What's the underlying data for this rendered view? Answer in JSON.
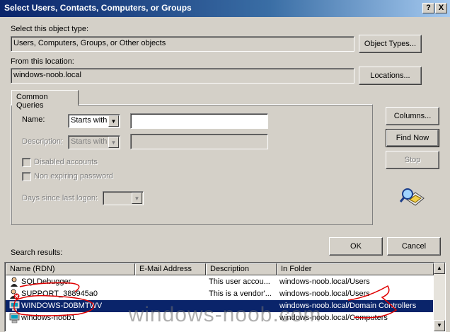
{
  "window": {
    "title": "Select Users, Contacts, Computers, or Groups",
    "help_btn": "?",
    "close_btn": "X"
  },
  "object_type": {
    "label": "Select this object type:",
    "value": "Users, Computers, Groups, or Other objects",
    "button": "Object Types..."
  },
  "location": {
    "label": "From this location:",
    "value": "windows-noob.local",
    "button": "Locations..."
  },
  "common_queries": {
    "tab": "Common Queries",
    "name_label": "Name:",
    "name_mode": "Starts with",
    "name_value": "",
    "description_label": "Description:",
    "description_mode": "Starts with",
    "disabled_accounts": "Disabled accounts",
    "non_expiring_password": "Non expiring password",
    "days_since_logon": "Days since last logon:"
  },
  "buttons": {
    "columns": "Columns...",
    "find_now": "Find Now",
    "stop": "Stop",
    "ok": "OK",
    "cancel": "Cancel"
  },
  "results": {
    "label": "Search results:",
    "columns": [
      "Name (RDN)",
      "E-Mail Address",
      "Description",
      "In Folder"
    ],
    "rows": [
      {
        "name": "SQLDebugger",
        "email": "",
        "description": "This user accou...",
        "folder": "windows-noob.local/Users"
      },
      {
        "name": "SUPPORT_388945a0",
        "email": "",
        "description": "This is a vendor'...",
        "folder": "windows-noob.local/Users"
      },
      {
        "name": "WINDOWS-D0BMTWV",
        "email": "",
        "description": "",
        "folder": "windows-noob.local/Domain Controllers"
      },
      {
        "name": "windows-noob1",
        "email": "",
        "description": "",
        "folder": "windows-noob.local/Computers"
      }
    ]
  },
  "watermark": "windows-noob.com",
  "colors": {
    "selection": "#0a246a",
    "annotation": "#e00000",
    "face": "#d4d0c8"
  }
}
